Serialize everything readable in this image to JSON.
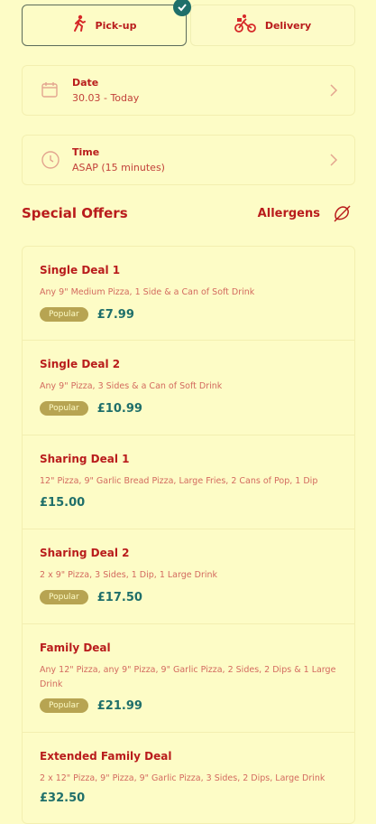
{
  "mode": {
    "pickup_label": "Pick-up",
    "delivery_label": "Delivery"
  },
  "date": {
    "title": "Date",
    "value": "30.03 - Today"
  },
  "time": {
    "title": "Time",
    "value": "ASAP (15 minutes)"
  },
  "section": {
    "title": "Special Offers",
    "allergens_label": "Allergens"
  },
  "offers": [
    {
      "name": "Single Deal 1",
      "desc": "Any 9\" Medium Pizza, 1 Side & a Can of Soft Drink",
      "badge": "Popular",
      "price": "£7.99"
    },
    {
      "name": "Single Deal 2",
      "desc": "Any 9\" Pizza, 3 Sides & a Can of Soft Drink",
      "badge": "Popular",
      "price": "£10.99"
    },
    {
      "name": "Sharing Deal 1",
      "desc": "12\" Pizza, 9\" Garlic Bread Pizza, Large Fries, 2 Cans of Pop, 1 Dip",
      "badge": "",
      "price": "£15.00"
    },
    {
      "name": "Sharing Deal 2",
      "desc": "2 x 9\" Pizza, 3 Sides, 1 Dip, 1 Large Drink",
      "badge": "Popular",
      "price": "£17.50"
    },
    {
      "name": "Family Deal",
      "desc": "Any 12\" Pizza, any 9\" Pizza, 9\" Garlic Pizza, 2 Sides, 2 Dips & 1 Large Drink",
      "badge": "Popular",
      "price": "£21.99"
    },
    {
      "name": "Extended Family Deal",
      "desc": "2 x 12\" Pizza, 9\" Pizza, 9\" Garlic Pizza, 3 Sides, 2 Dips, Large Drink",
      "badge": "",
      "price": "£32.50"
    }
  ],
  "colors": {
    "background": "#fdfcc6",
    "brand_red": "#b91c1c",
    "price_teal": "#1f6f6a",
    "badge": "#b7a452"
  }
}
